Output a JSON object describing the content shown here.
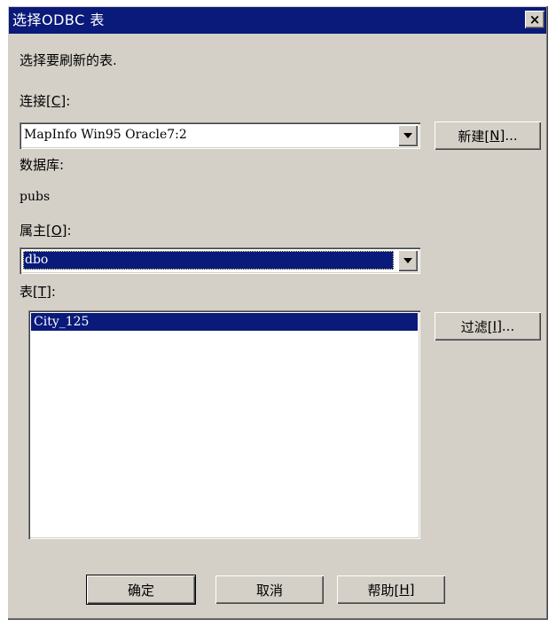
{
  "window": {
    "title": "选择ODBC 表",
    "close_glyph": "×"
  },
  "instruction": "选择要刷新的表.",
  "connection": {
    "label_prefix": "连接[",
    "label_key": "C",
    "label_suffix": "]:",
    "value": "MapInfo Win95 Oracle7:2",
    "new_button_prefix": "新建[",
    "new_button_key": "N",
    "new_button_suffix": "]..."
  },
  "database": {
    "label": "数据库:",
    "value": "pubs"
  },
  "owner": {
    "label_prefix": "属主[",
    "label_key": "O",
    "label_suffix": "]:",
    "value": "dbo"
  },
  "tables": {
    "label_prefix": "表[",
    "label_key": "T",
    "label_suffix": "]:",
    "items": [
      "City_125"
    ],
    "selected_index": 0,
    "filter_button_prefix": "过滤[",
    "filter_button_key": "I",
    "filter_button_suffix": "]..."
  },
  "footer": {
    "ok_label": "确定",
    "cancel_label": "取消",
    "help_prefix": "帮助[",
    "help_key": "H",
    "help_suffix": "]"
  },
  "colors": {
    "titlebar": "#0a1a7a",
    "face": "#d4d0c8",
    "selection": "#0a1a7a"
  }
}
